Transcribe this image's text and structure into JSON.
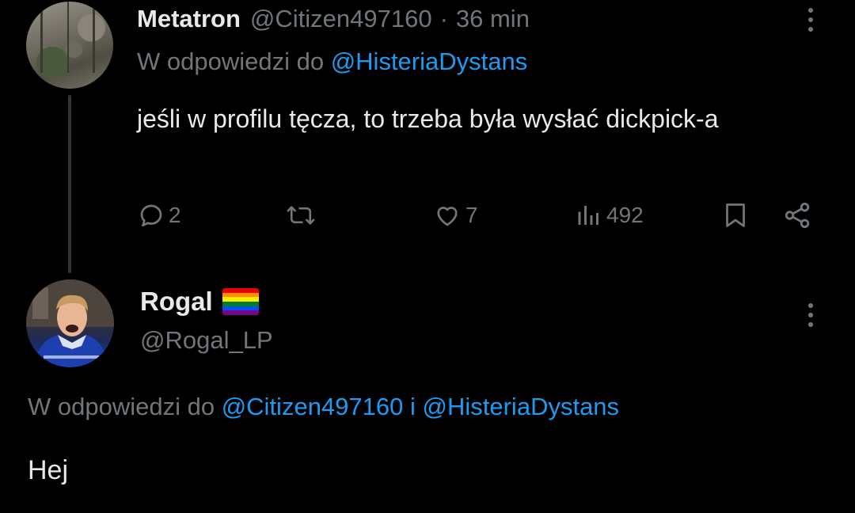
{
  "tweet1": {
    "author_name": "Metatron",
    "author_handle": "@Citizen497160",
    "separator": "·",
    "time": "36 min",
    "reply_prefix": "W odpowiedzi do",
    "reply_mention": "@HisteriaDystans",
    "text": "jeśli w profilu tęcza, to trzeba była wysłać dickpick-a",
    "actions": {
      "replies": "2",
      "reposts": "",
      "likes": "7",
      "views": "492"
    },
    "icons": [
      "reply-icon",
      "repost-icon",
      "like-icon",
      "views-icon",
      "bookmark-icon",
      "share-icon",
      "more-icon"
    ]
  },
  "tweet2": {
    "author_name": "Rogal",
    "author_emoji": "rainbow-flag",
    "author_handle": "@Rogal_LP",
    "reply_prefix": "W odpowiedzi do",
    "reply_mention_1": "@Citizen497160",
    "reply_joiner": "i",
    "reply_mention_2": "@HisteriaDystans",
    "text": "Hej"
  },
  "colors": {
    "background": "#000000",
    "primary_text": "#e7e9ea",
    "secondary_text": "#71767b",
    "link": "#1d9bf0",
    "thread_line": "#333639",
    "flag": [
      "#e40303",
      "#ff8c00",
      "#ffed00",
      "#008026",
      "#004dff",
      "#750787"
    ]
  }
}
